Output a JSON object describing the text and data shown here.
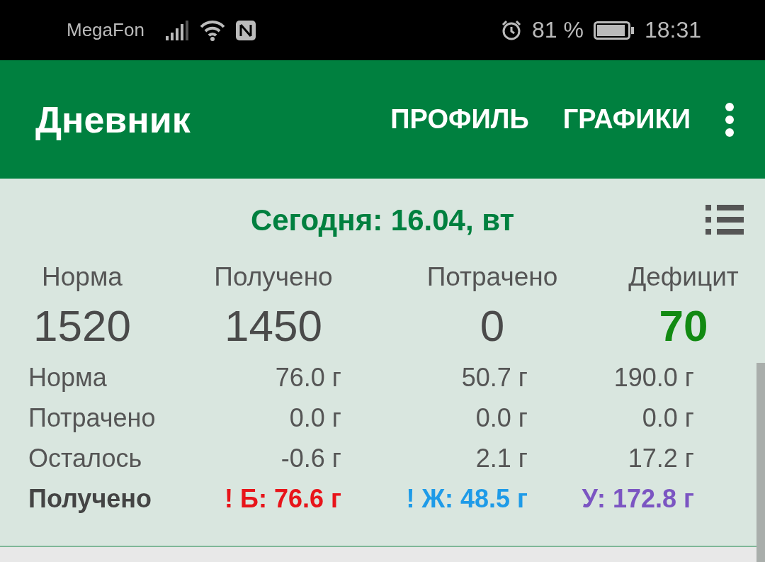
{
  "status_bar": {
    "carrier": "MegaFon",
    "battery": "81 %",
    "time": "18:31"
  },
  "app_bar": {
    "title": "Дневник",
    "actions": [
      "ПРОФИЛЬ",
      "ГРАФИКИ"
    ]
  },
  "date_title": "Сегодня: 16.04, вт",
  "summary": [
    {
      "label": "Норма",
      "value": "1520",
      "highlight": false
    },
    {
      "label": "Получено",
      "value": "1450",
      "highlight": false
    },
    {
      "label": "Потрачено",
      "value": "0",
      "highlight": false
    },
    {
      "label": "Дефицит",
      "value": "70",
      "highlight": true
    }
  ],
  "macros": {
    "rows": [
      {
        "label": "Норма",
        "values": [
          "76.0 г",
          "50.7 г",
          "190.0 г"
        ]
      },
      {
        "label": "Потрачено",
        "values": [
          "0.0 г",
          "0.0 г",
          "0.0 г"
        ]
      },
      {
        "label": "Осталось",
        "values": [
          "-0.6 г",
          "2.1 г",
          "17.2 г"
        ]
      }
    ],
    "received": {
      "label": "Получено",
      "items": [
        {
          "text": "! Б: 76.6 г",
          "color": "#e8141a"
        },
        {
          "text": "! Ж: 48.5 г",
          "color": "#1e9be8"
        },
        {
          "text": "У: 172.8 г",
          "color": "#7b55c2"
        }
      ]
    }
  }
}
